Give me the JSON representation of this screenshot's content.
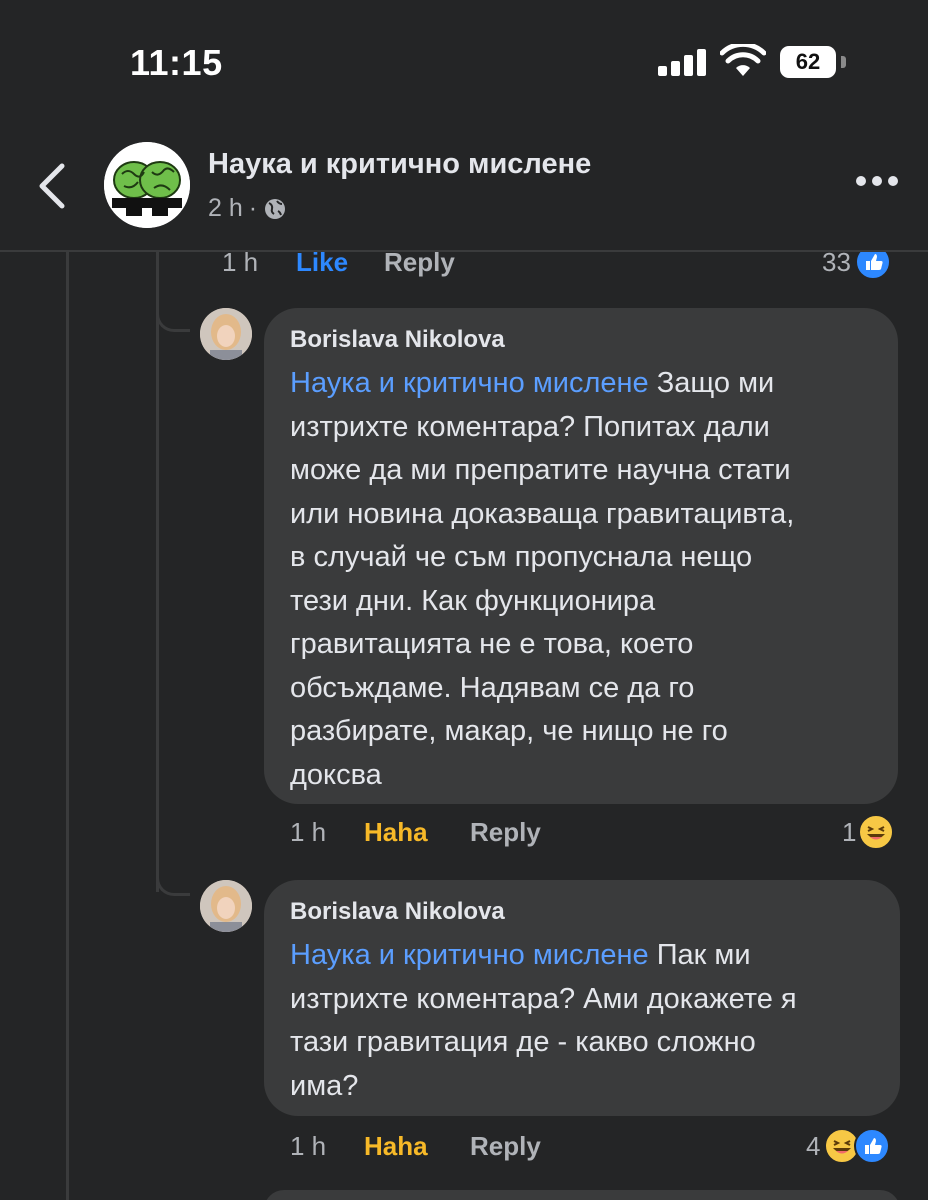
{
  "status_bar": {
    "time": "11:15",
    "battery": "62"
  },
  "header": {
    "title": "Наука и критично мислене",
    "meta_time": "2 h",
    "meta_separator": "·",
    "back_icon": "chevron-left-icon",
    "more_icon": "more-horizontal-icon",
    "privacy_icon": "globe-icon"
  },
  "top_action_row": {
    "time": "1 h",
    "reaction": "Like",
    "reply": "Reply",
    "count": "33"
  },
  "comments": [
    {
      "author": "Borislava Nikolova",
      "mention": "Наука и критично мислене",
      "lines": [
        " Защо ми",
        "изтрихте коментара? Попитах дали",
        "може да ми препратите научна стати",
        "или новина доказваща гравитацивта,",
        "в случай че съм пропуснала нещо",
        "тези дни. Как функционира",
        "гравитацията не е това, което",
        "обсъждаме. Надявам се да го",
        "разбирате, макар, че нищо не го",
        "доксва"
      ],
      "time": "1 h",
      "reaction": "Haha",
      "reply": "Reply",
      "count": "1"
    },
    {
      "author": "Borislava Nikolova",
      "mention": "Наука и критично мислене",
      "lines": [
        " Пак ми",
        "изтрихте коментара? Ами докажете я",
        "тази гравитация де - какво сложно",
        "има?"
      ],
      "time": "1 h",
      "reaction": "Haha",
      "reply": "Reply",
      "count": "4"
    }
  ],
  "colors": {
    "background": "#242526",
    "bubble": "#3a3b3c",
    "mention": "#5b9eff",
    "like": "#2d88ff",
    "haha": "#f7b928"
  }
}
